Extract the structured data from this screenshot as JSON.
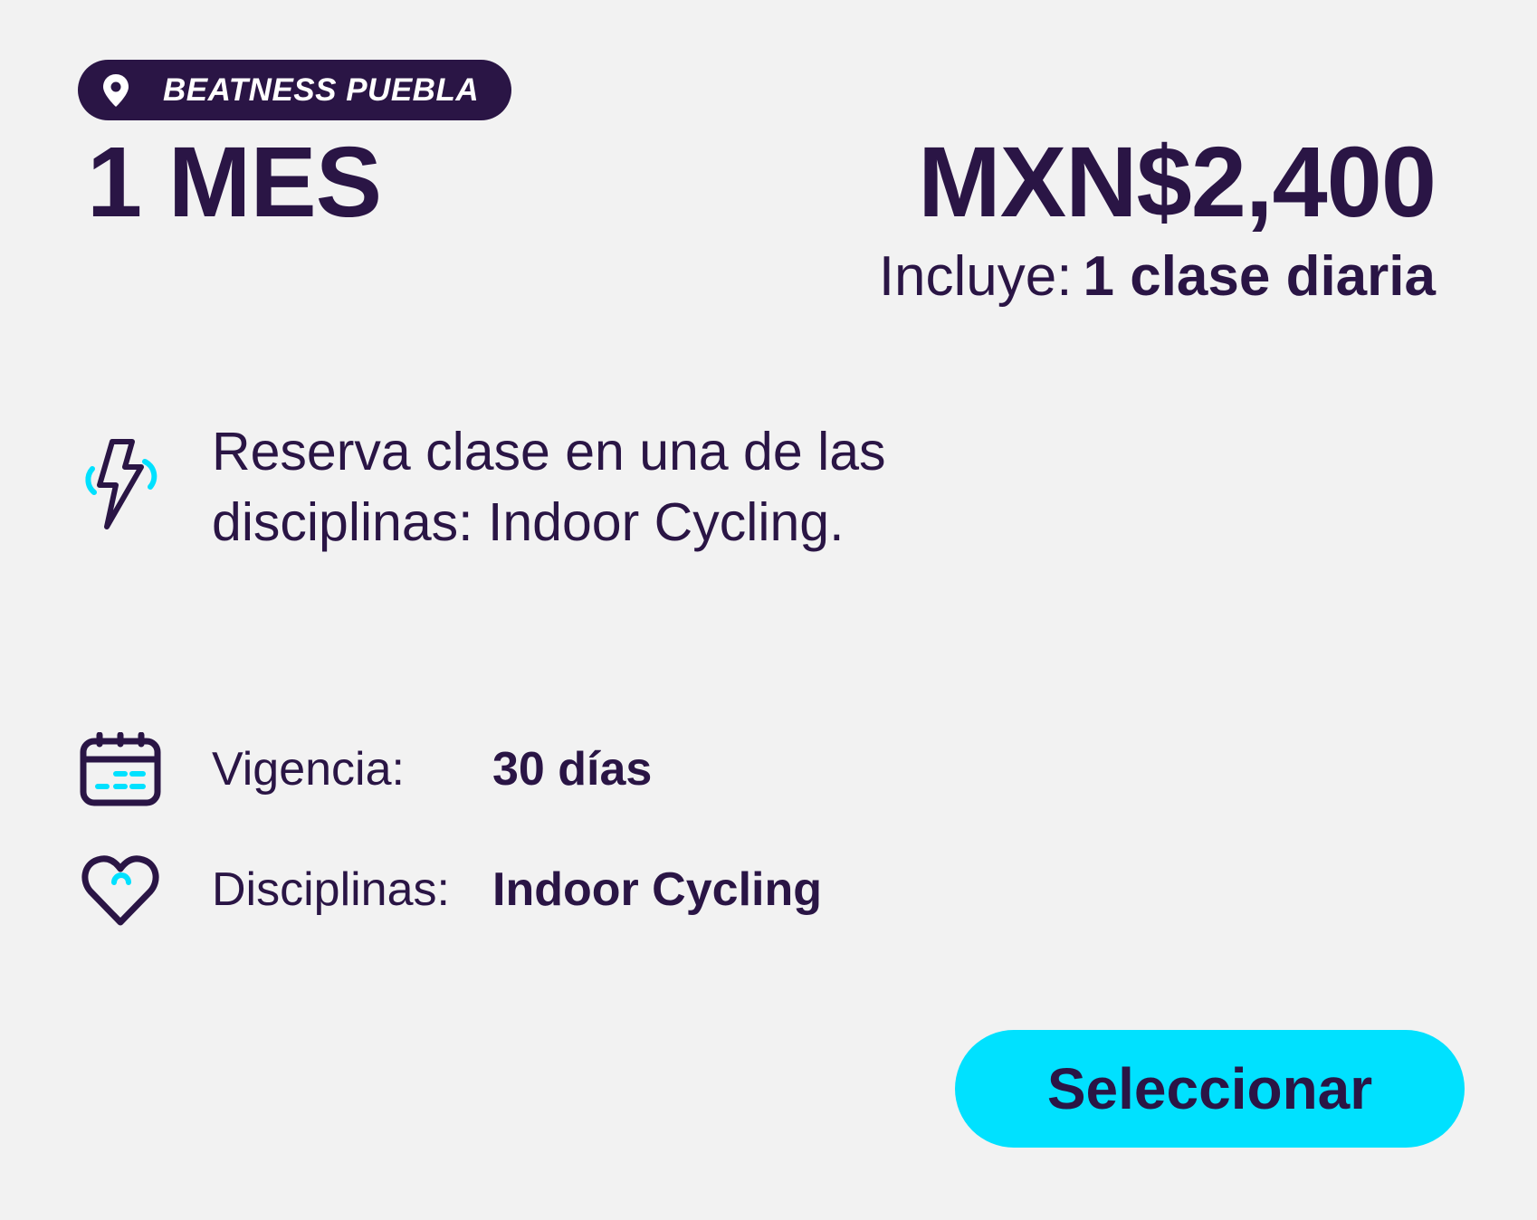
{
  "location": {
    "icon": "map-pin-icon",
    "label": "BEATNESS PUEBLA"
  },
  "plan": {
    "name": "1 MES",
    "price": "MXN$2,400",
    "includes_label": "Incluye:",
    "includes_value": "1 clase diaria"
  },
  "feature": {
    "icon": "lightning-bolt-icon",
    "text": "Reserva clase en una de las disciplinas: Indoor Cycling."
  },
  "details": {
    "validity": {
      "icon": "calendar-icon",
      "label": "Vigencia:",
      "value": "30 días"
    },
    "disciplines": {
      "icon": "heart-icon",
      "label": "Disciplinas:",
      "value": "Indoor Cycling"
    }
  },
  "action": {
    "select_label": "Seleccionar"
  },
  "colors": {
    "background": "#f2f2f2",
    "primary_dark": "#2a1545",
    "accent_cyan": "#00e1ff",
    "pill_text": "#ffffff"
  }
}
